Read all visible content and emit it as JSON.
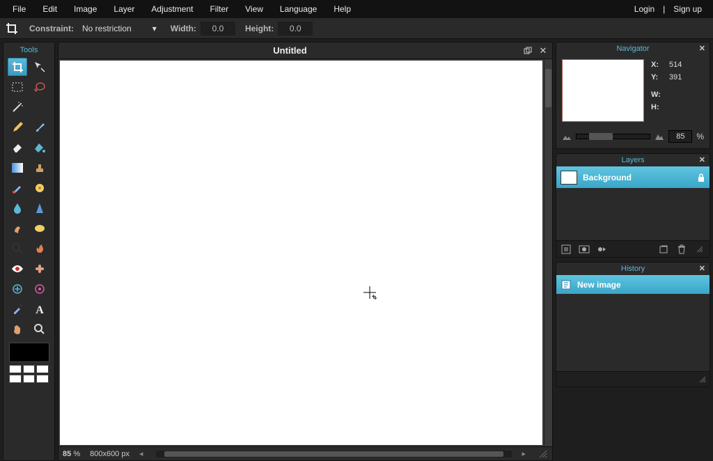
{
  "menubar": {
    "items": [
      "File",
      "Edit",
      "Image",
      "Layer",
      "Adjustment",
      "Filter",
      "View",
      "Language",
      "Help"
    ],
    "login": "Login",
    "signup": "Sign up"
  },
  "toolbar": {
    "constraint_label": "Constraint:",
    "constraint_value": "No restriction",
    "width_label": "Width:",
    "width_value": "0.0",
    "height_label": "Height:",
    "height_value": "0.0"
  },
  "tools": {
    "title": "Tools",
    "items": [
      "crop-tool",
      "move-tool",
      "marquee-tool",
      "lasso-tool",
      "wand-tool",
      "",
      "pencil-tool",
      "brush-tool",
      "eraser-tool",
      "paint-bucket-tool",
      "gradient-tool",
      "clone-stamp-tool",
      "color-replace-tool",
      "drawing-tool",
      "blur-tool",
      "sharpen-tool",
      "smudge-tool",
      "sponge-tool",
      "dodge-tool",
      "burn-tool",
      "red-eye-tool",
      "spot-heal-tool",
      "bloat-tool",
      "pinch-tool",
      "color-picker-tool",
      "type-tool",
      "hand-tool",
      "zoom-tool"
    ]
  },
  "canvas": {
    "title": "Untitled",
    "zoom": "85",
    "zoom_unit": "%",
    "dimensions": "800x600 px"
  },
  "navigator": {
    "title": "Navigator",
    "x_label": "X:",
    "x_value": "514",
    "y_label": "Y:",
    "y_value": "391",
    "w_label": "W:",
    "w_value": "",
    "h_label": "H:",
    "h_value": "",
    "zoom": "85",
    "zoom_unit": "%"
  },
  "layers": {
    "title": "Layers",
    "items": [
      {
        "name": "Background",
        "locked": true
      }
    ]
  },
  "history": {
    "title": "History",
    "items": [
      {
        "name": "New image"
      }
    ]
  }
}
